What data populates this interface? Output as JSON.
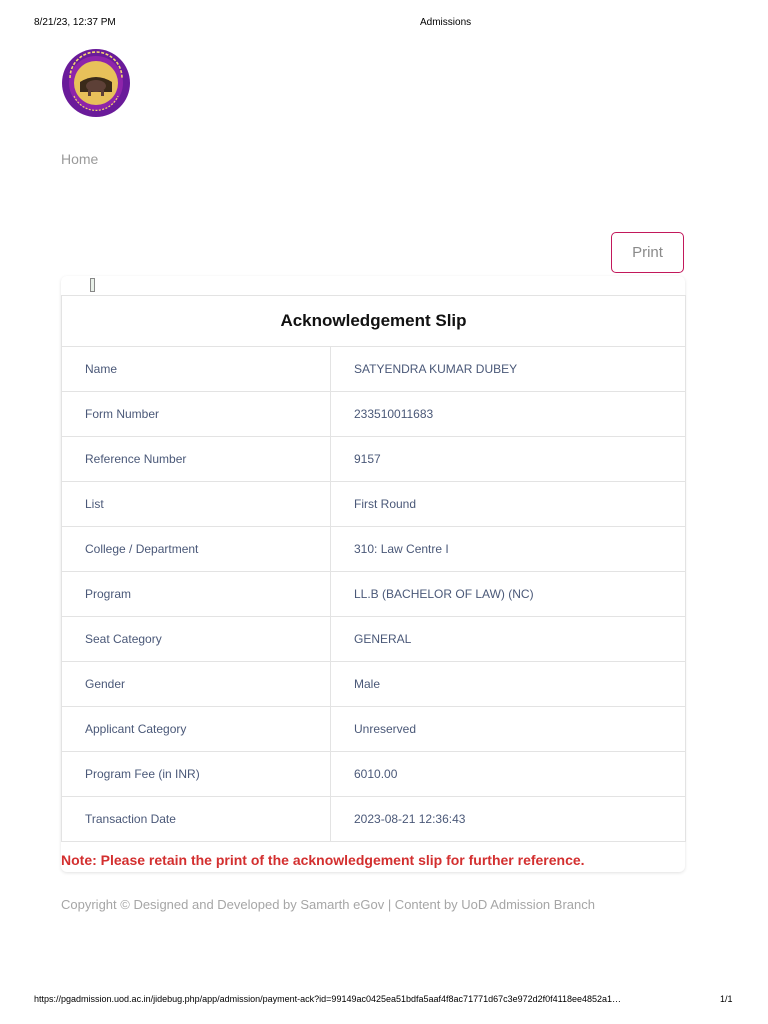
{
  "print_header": {
    "datetime": "8/21/23, 12:37 PM",
    "title": "Admissions"
  },
  "logo": {
    "top_text": "UNIVERSITY OF DELHI",
    "motto": "निष्ठा धृति: सत्यम्",
    "colors": {
      "ring": "#6a1b9a",
      "inner": "#e1b84b",
      "text": "#f5d76e"
    }
  },
  "nav": {
    "home_label": "Home"
  },
  "actions": {
    "print_label": "Print"
  },
  "slip": {
    "title": "Acknowledgement Slip",
    "rows": [
      {
        "label": "Name",
        "value": "SATYENDRA KUMAR DUBEY"
      },
      {
        "label": "Form Number",
        "value": "233510011683"
      },
      {
        "label": "Reference Number",
        "value": "9157"
      },
      {
        "label": "List",
        "value": "First Round"
      },
      {
        "label": "College / Department",
        "value": "310: Law Centre I"
      },
      {
        "label": "Program",
        "value": "LL.B (BACHELOR OF LAW) (NC)"
      },
      {
        "label": "Seat Category",
        "value": "GENERAL"
      },
      {
        "label": "Gender",
        "value": "Male"
      },
      {
        "label": "Applicant Category",
        "value": "Unreserved"
      },
      {
        "label": "Program Fee (in INR)",
        "value": "6010.00"
      },
      {
        "label": "Transaction Date",
        "value": "2023-08-21 12:36:43"
      }
    ],
    "note": "Note: Please retain the print of the acknowledgement slip for further reference."
  },
  "footer": {
    "copyright": "Copyright © Designed and Developed by Samarth eGov | Content by UoD Admission Branch"
  },
  "print_footer": {
    "url": "https://pgadmission.uod.ac.in/jidebug.php/app/admission/payment-ack?id=99149ac0425ea51bdfa5aaf4f8ac71771d67c3e972d2f0f4118ee4852a1…",
    "page": "1/1"
  },
  "colors": {
    "print_border": "#c2185b",
    "note": "#d32f2f",
    "cell_text": "#4a5878"
  }
}
